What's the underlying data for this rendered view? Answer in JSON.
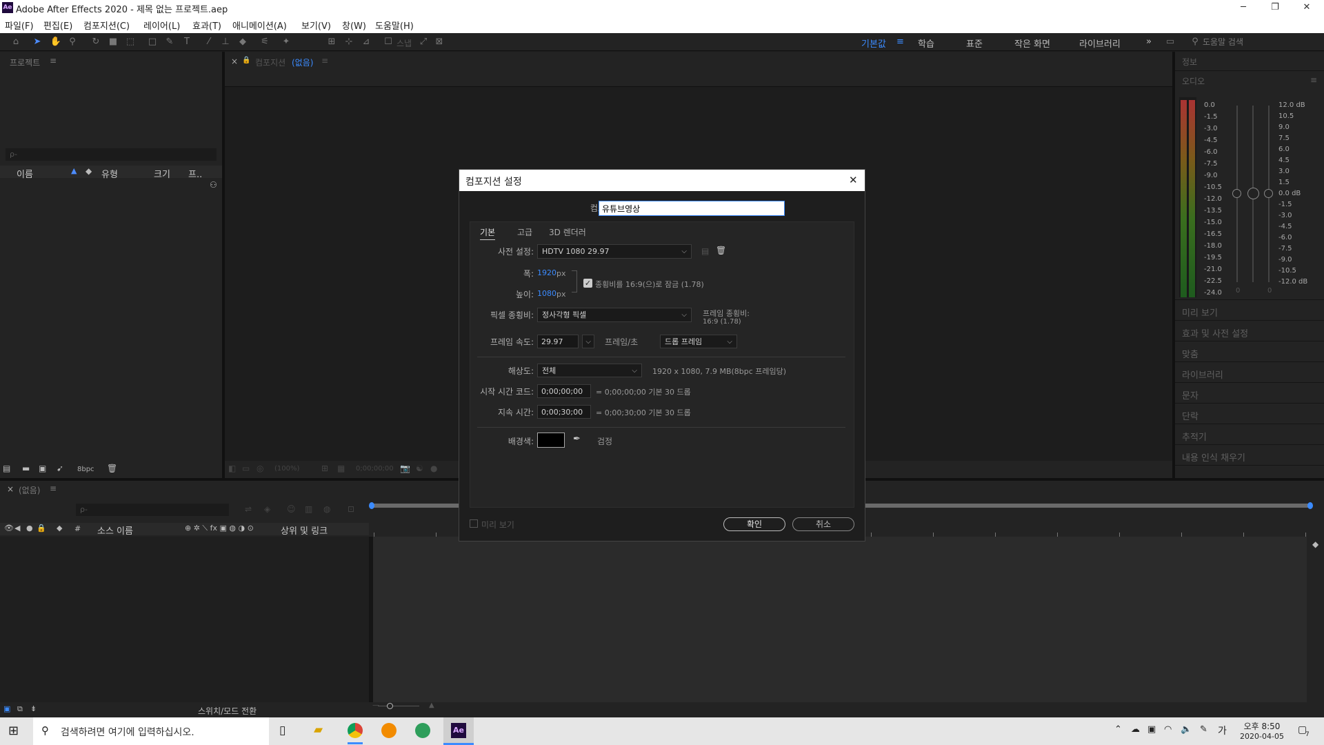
{
  "window": {
    "app_icon": "Ae",
    "title": "Adobe After Effects 2020 - 제목 없는 프로젝트.aep",
    "minimize": "─",
    "maximize": "❐",
    "close": "✕"
  },
  "menu": [
    "파일(F)",
    "편집(E)",
    "컴포지션(C)",
    "레이어(L)",
    "효과(T)",
    "애니메이션(A)",
    "보기(V)",
    "창(W)",
    "도움말(H)"
  ],
  "toolbar": {
    "snap_label": "스냅",
    "workspaces": [
      "기본값",
      "학습",
      "표준",
      "작은 화면",
      "라이브러리"
    ],
    "active_workspace": "기본값",
    "more": "»",
    "help_search_placeholder": "도움말 검색"
  },
  "project_panel": {
    "title": "프로젝트",
    "menu": "≡",
    "search_placeholder": "ρ-",
    "columns": [
      "이름",
      "유형",
      "크기",
      "프.."
    ],
    "bpc": "8bpc"
  },
  "comp_panel": {
    "close": "×",
    "title_prefix": "컴포지션",
    "title_highlight": "(없음)",
    "menu": "≡",
    "zoom": "(100%)",
    "timecode": "0;00;00;00"
  },
  "timeline_panel": {
    "close": "×",
    "title": "(없음)",
    "menu": "≡",
    "search_placeholder": "ρ-",
    "col_num": "#",
    "col_source": "소스 이름",
    "col_parent": "상위 및 링크",
    "footer_toggle": "스위치/모드 전환"
  },
  "right_panel": {
    "info": "정보",
    "audio": "오디오",
    "audio_menu": "≡",
    "items": [
      "미리 보기",
      "효과 및 사전 설정",
      "맞춤",
      "라이브러리",
      "문자",
      "단락",
      "추적기",
      "내용 인식 채우기"
    ],
    "left_scale": [
      "0.0",
      "-1.5",
      "-3.0",
      "-4.5",
      "-6.0",
      "-7.5",
      "-9.0",
      "-10.5",
      "-12.0",
      "-13.5",
      "-15.0",
      "-16.5",
      "-18.0",
      "-19.5",
      "-21.0",
      "-22.5",
      "-24.0"
    ],
    "right_scale": [
      "12.0 dB",
      "10.5",
      "9.0",
      "7.5",
      "6.0",
      "4.5",
      "3.0",
      "1.5",
      "0.0 dB",
      "-1.5",
      "-3.0",
      "-4.5",
      "-6.0",
      "-7.5",
      "-9.0",
      "-10.5",
      "-12.0 dB"
    ],
    "slider_zero": "0"
  },
  "dialog": {
    "title": "컴포지션 설정",
    "close": "✕",
    "name_label": "컴포지션 이름:",
    "name_value": "유튜브영상",
    "tabs": [
      "기본",
      "고급",
      "3D 렌더러"
    ],
    "preset_label": "사전 설정:",
    "preset_value": "HDTV 1080 29.97",
    "width_label": "폭:",
    "width_value": "1920",
    "unit_px": "px",
    "height_label": "높이:",
    "height_value": "1080",
    "lock_label": "종횡비를 16:9(으)로 잠금 (1.78)",
    "pixel_label": "픽셀 종횡비:",
    "pixel_value": "정사각형 픽셀",
    "frame_aspect_label": "프레임 종횡비:",
    "frame_aspect_value": "16:9 (1.78)",
    "fps_label": "프레임 속도:",
    "fps_value": "29.97",
    "fps_unit": "프레임/초",
    "drop_value": "드롭 프레임",
    "res_label": "해상도:",
    "res_value": "전체",
    "res_info": "1920 x 1080, 7.9 MB(8bpc 프레임당)",
    "start_label": "시작 시간 코드:",
    "start_value": "0;00;00;00",
    "start_info": "= 0;00;00;00  기본 30  드롭",
    "dur_label": "지속 시간:",
    "dur_value": "0;00;30;00",
    "dur_info": "= 0;00;30;00  기본 30  드롭",
    "bg_label": "배경색:",
    "bg_name": "검정",
    "bg_color": "#000000",
    "preview_label": "미리 보기",
    "ok": "확인",
    "cancel": "취소"
  },
  "taskbar": {
    "search_placeholder": "검색하려면 여기에 입력하십시오.",
    "time": "오후 8:50",
    "date": "2020-04-05",
    "ime": "가",
    "notif": "7"
  },
  "colors": {
    "accent_blue": "#3b8bff",
    "panel_bg": "#232323",
    "dialog_bg": "#1e1e1e"
  }
}
